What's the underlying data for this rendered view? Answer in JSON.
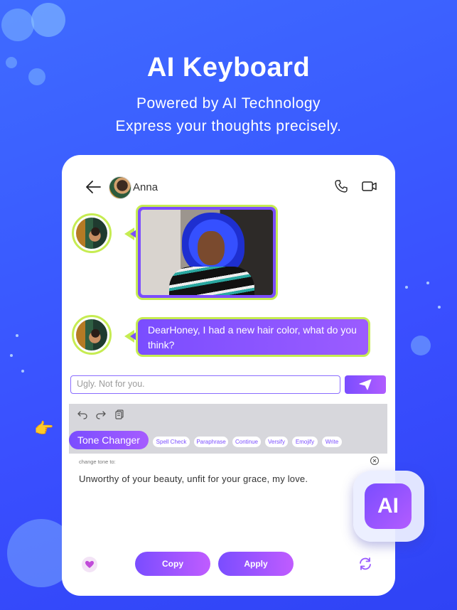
{
  "colors": {
    "background": "#3a56ff",
    "accent_purple": "#7a4dff",
    "accent_lime": "#c6ec52"
  },
  "hero": {
    "title": "AI Keyboard",
    "subtitle_1": "Powered by AI Technology",
    "subtitle_2": "Express your thoughts precisely."
  },
  "chat": {
    "contact_name": "Anna",
    "message_text": "DearHoney, I had a new hair color, what do you think?",
    "input_value": "Ugly. Not  for you."
  },
  "keyboard": {
    "tone_changer_label": "Tone Changer",
    "chips": [
      "Spell Check",
      "Paraphrase",
      "Continue",
      "Versify",
      "Emojify",
      "Write"
    ],
    "hint_label": "change tone to:",
    "result_text": "Unworthy of your beauty, unfit for your grace, my love.",
    "copy_label": "Copy",
    "apply_label": "Apply"
  },
  "badge": {
    "label": "AI"
  },
  "icons": {
    "back": "arrow-left-icon",
    "phone": "phone-icon",
    "video": "video-camera-icon",
    "send": "paper-plane-icon",
    "undo": "undo-icon",
    "redo": "redo-icon",
    "clipboard": "clipboard-icon",
    "close": "close-circle-icon",
    "heart": "heart-icon",
    "refresh": "refresh-icon",
    "pointer": "pointing-hand-icon"
  }
}
